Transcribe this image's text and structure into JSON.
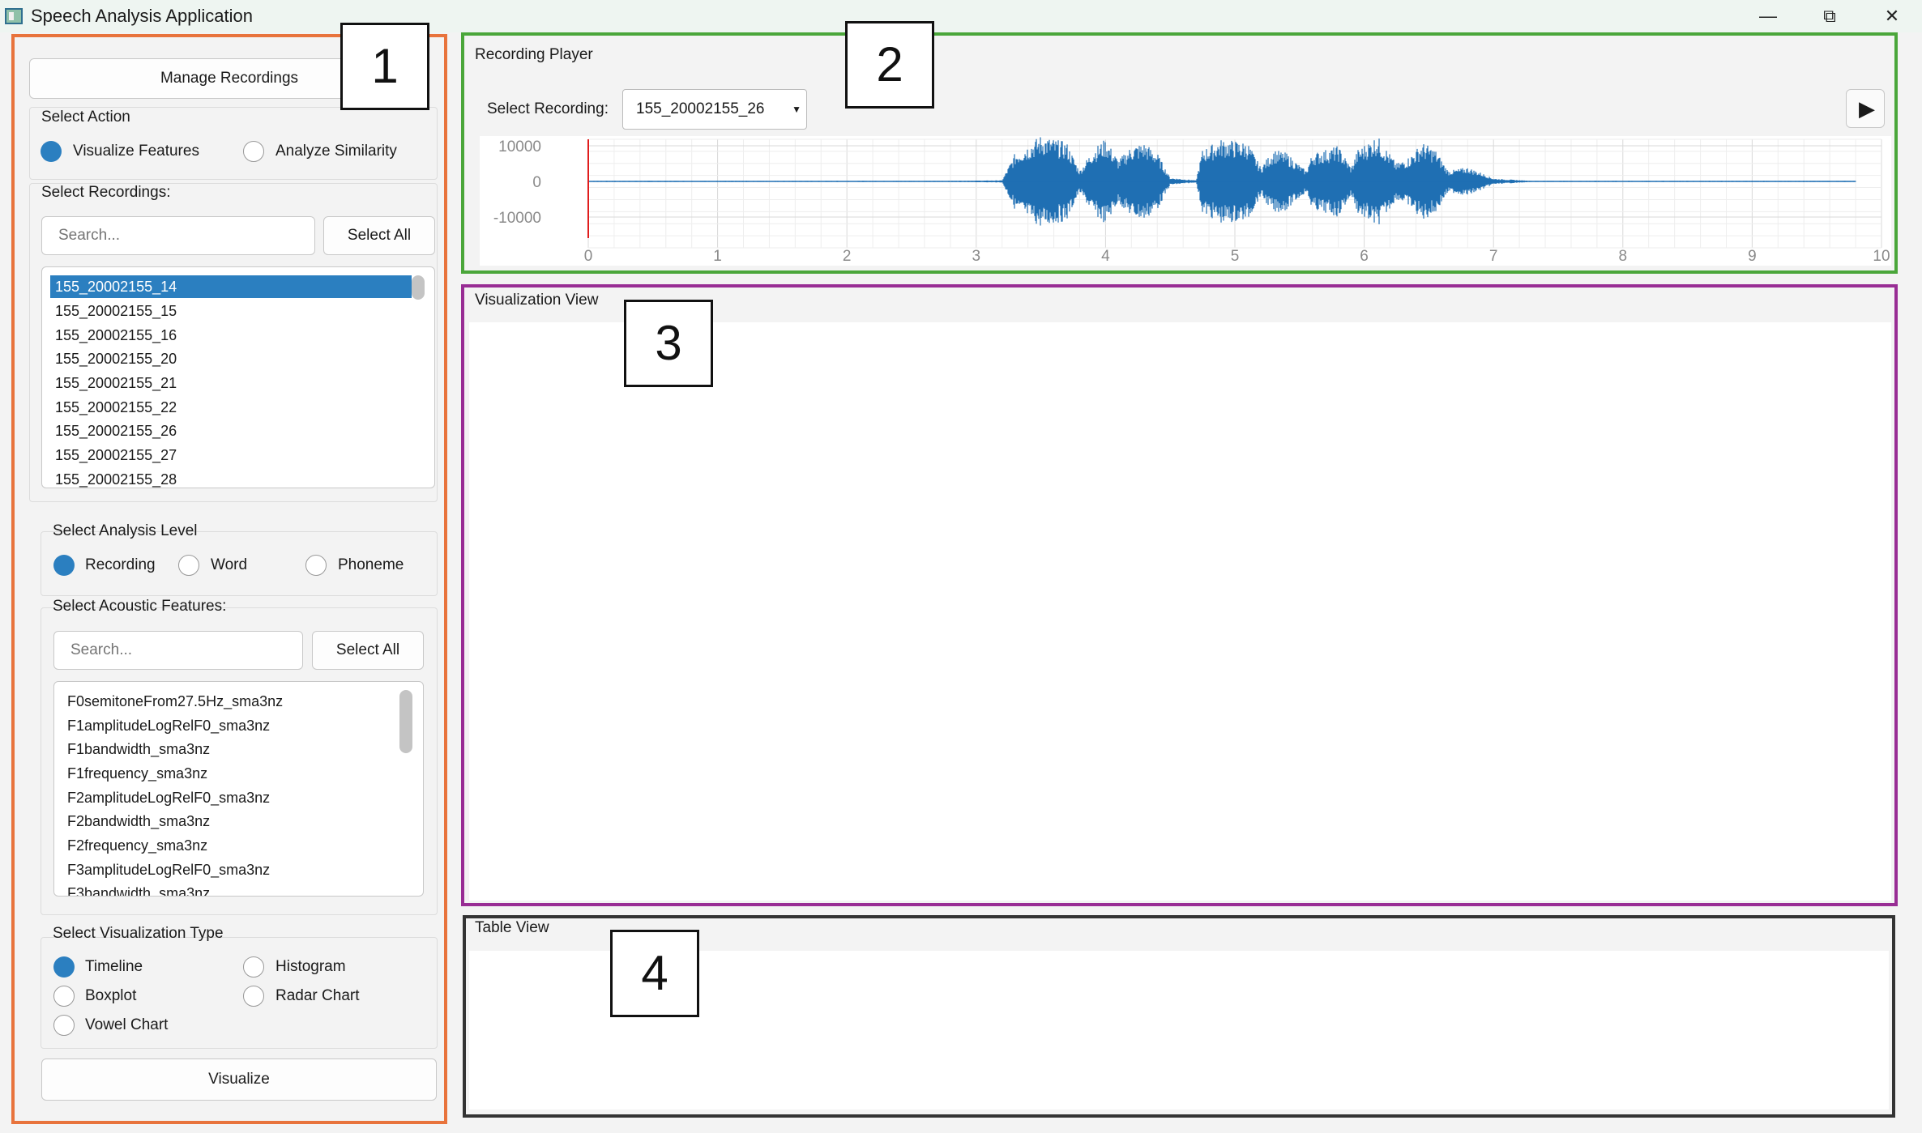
{
  "window": {
    "title": "Speech Analysis Application",
    "min_glyph": "—",
    "max_glyph": "⧉",
    "close_glyph": "✕"
  },
  "markers": [
    "1",
    "2",
    "3",
    "4"
  ],
  "left_panel": {
    "manage_button": "Manage Recordings",
    "select_action": {
      "title": "Select Action",
      "options": [
        "Visualize Features",
        "Analyze Similarity"
      ],
      "selected": 0
    },
    "recordings": {
      "title": "Select Recordings:",
      "search_placeholder": "Search...",
      "select_all": "Select All",
      "items": [
        "155_20002155_14",
        "155_20002155_15",
        "155_20002155_16",
        "155_20002155_20",
        "155_20002155_21",
        "155_20002155_22",
        "155_20002155_26",
        "155_20002155_27",
        "155_20002155_28"
      ],
      "selected_index": 0
    },
    "analysis_level": {
      "title": "Select Analysis Level",
      "options": [
        "Recording",
        "Word",
        "Phoneme"
      ],
      "selected": 0
    },
    "acoustic": {
      "title": "Select Acoustic Features:",
      "search_placeholder": "Search...",
      "select_all": "Select All",
      "items": [
        "F0semitoneFrom27.5Hz_sma3nz",
        "F1amplitudeLogRelF0_sma3nz",
        "F1bandwidth_sma3nz",
        "F1frequency_sma3nz",
        "F2amplitudeLogRelF0_sma3nz",
        "F2bandwidth_sma3nz",
        "F2frequency_sma3nz",
        "F3amplitudeLogRelF0_sma3nz",
        "F3bandwidth_sma3nz"
      ]
    },
    "vis_type": {
      "title": "Select Visualization Type",
      "options": [
        "Timeline",
        "Histogram",
        "Boxplot",
        "Radar Chart",
        "Vowel Chart"
      ],
      "selected": 0
    },
    "visualize_button": "Visualize"
  },
  "player": {
    "title": "Recording Player",
    "select_label": "Select Recording:",
    "selected_recording": "155_20002155_26",
    "play_glyph": "▶"
  },
  "chart_data": {
    "type": "area",
    "x_ticks": [
      "0",
      "1",
      "2",
      "3",
      "4",
      "5",
      "6",
      "7",
      "8",
      "9",
      "10"
    ],
    "y_ticks": [
      "10000",
      "0",
      "-10000"
    ],
    "xlim": [
      0,
      10
    ],
    "ylim": [
      -15000,
      15000
    ],
    "playhead_x": 0,
    "grid": true,
    "envelope": [
      [
        0.0,
        150
      ],
      [
        2.8,
        150
      ],
      [
        3.2,
        300
      ],
      [
        3.3,
        8000
      ],
      [
        3.5,
        13000
      ],
      [
        3.7,
        11000
      ],
      [
        3.8,
        3000
      ],
      [
        3.9,
        9000
      ],
      [
        4.0,
        12000
      ],
      [
        4.1,
        6000
      ],
      [
        4.2,
        10000
      ],
      [
        4.3,
        11000
      ],
      [
        4.4,
        8000
      ],
      [
        4.5,
        1000
      ],
      [
        4.7,
        300
      ],
      [
        4.75,
        9000
      ],
      [
        4.9,
        12000
      ],
      [
        5.1,
        11000
      ],
      [
        5.2,
        4000
      ],
      [
        5.3,
        9000
      ],
      [
        5.4,
        8000
      ],
      [
        5.55,
        3000
      ],
      [
        5.6,
        8000
      ],
      [
        5.8,
        10000
      ],
      [
        5.9,
        4000
      ],
      [
        5.95,
        9000
      ],
      [
        6.1,
        13000
      ],
      [
        6.25,
        5000
      ],
      [
        6.35,
        7000
      ],
      [
        6.45,
        11000
      ],
      [
        6.55,
        9000
      ],
      [
        6.65,
        3000
      ],
      [
        6.8,
        4000
      ],
      [
        6.9,
        2500
      ],
      [
        7.0,
        800
      ],
      [
        7.3,
        150
      ],
      [
        9.8,
        150
      ]
    ]
  },
  "visualization": {
    "title": "Visualization View"
  },
  "table": {
    "title": "Table View"
  }
}
